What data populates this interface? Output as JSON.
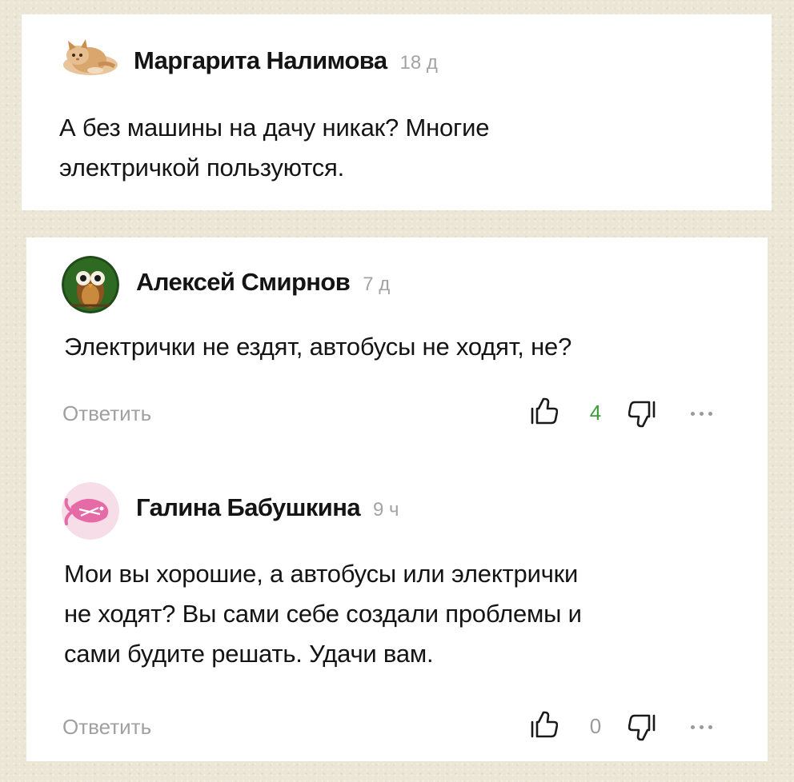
{
  "comments": [
    {
      "author": "Маргарита Налимова",
      "time": "18 д",
      "avatar_icon": "kitten-avatar-icon",
      "lines": [
        "А без машины на дачу никак? Многие",
        "электричкой пользуются."
      ]
    },
    {
      "author": "Алексей Смирнов",
      "time": "7 д",
      "avatar_icon": "owl-avatar-icon",
      "lines": [
        "Электрички не ездят, автобусы не ходят, не?"
      ],
      "reply_label": "Ответить",
      "likes": "4"
    },
    {
      "author": "Галина Бабушкина",
      "time": "9 ч",
      "avatar_icon": "pink-fish-avatar-icon",
      "lines": [
        "Мои вы хорошие, а автобусы или электрички",
        "не ходят? Вы сами себе создали проблемы и",
        "сами будите решать. Удачи вам."
      ],
      "reply_label": "Ответить",
      "likes": "0"
    }
  ],
  "colors": {
    "background": "#ebe6d6",
    "card": "#ffffff",
    "positive_count": "#3c9e35",
    "muted": "#a0a0a0"
  }
}
